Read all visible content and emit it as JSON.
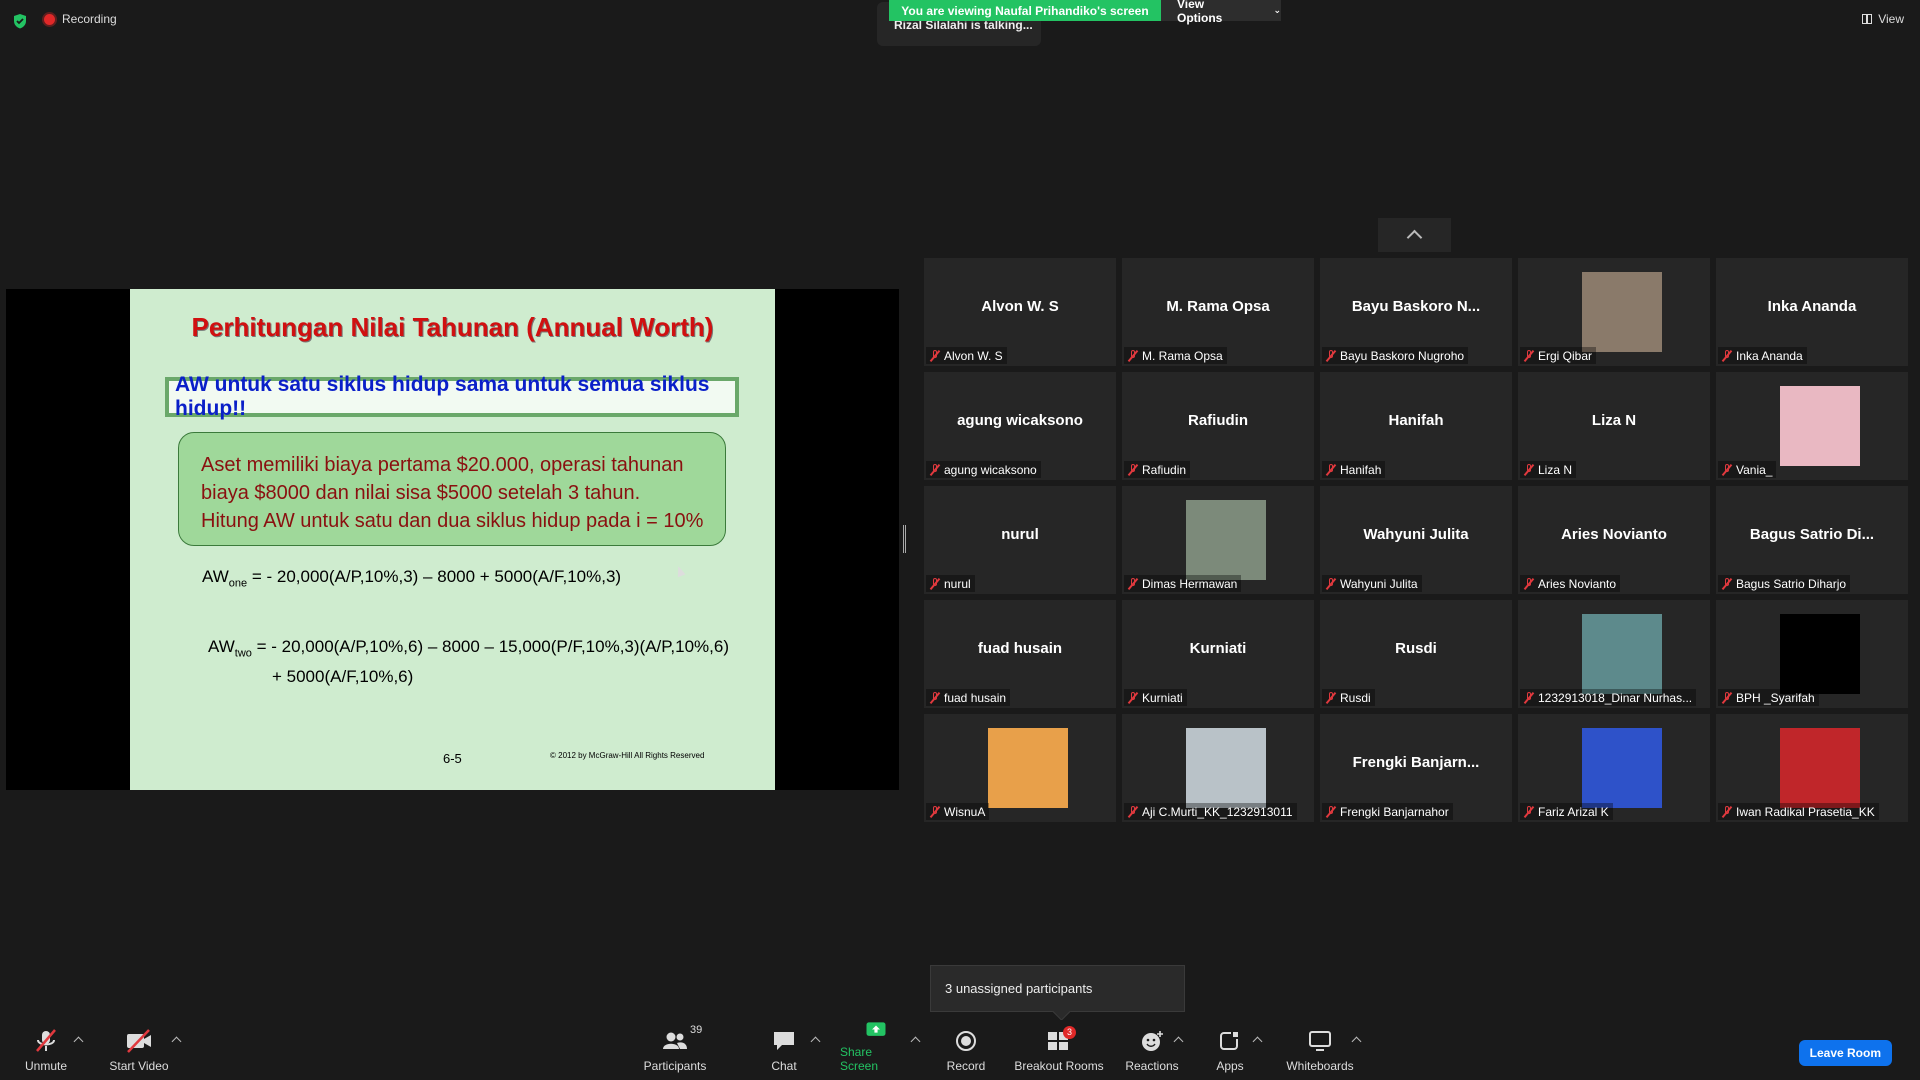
{
  "top": {
    "recording_label": "Recording",
    "talking": "Rizal Silalahi is talking...",
    "viewing": "You are viewing Naufal Prihandiko's screen",
    "view_options": "View Options",
    "view": "View"
  },
  "slide": {
    "title": "Perhitungan Nilai Tahunan (Annual Worth)",
    "box": "AW untuk satu siklus hidup sama untuk semua siklus hidup!!",
    "problem": [
      "Aset memiliki biaya pertama $20.000, operasi tahunan",
      "biaya $8000 dan nilai sisa $5000 setelah 3 tahun.",
      "Hitung AW untuk satu dan dua siklus hidup pada i = 10%"
    ],
    "eq1_lhs": "AW",
    "eq1_sub": "one",
    "eq1_rhs": " = - 20,000(A/P,10%,3) – 8000 + 5000(A/F,10%,3)",
    "eq2_lhs": "AW",
    "eq2_sub": "two",
    "eq2_rhs": " = - 20,000(A/P,10%,6) – 8000 – 15,000(P/F,10%,3)(A/P,10%,6)",
    "eq2_line2": "+ 5000(A/F,10%,6)",
    "page": "6-5",
    "copyright": "© 2012 by McGraw-Hill     All Rights Reserved"
  },
  "participants": [
    {
      "big": "Alvon W. S",
      "name": "Alvon W. S"
    },
    {
      "big": "M. Rama Opsa",
      "name": "M. Rama Opsa"
    },
    {
      "big": "Bayu Baskoro N...",
      "name": "Bayu Baskoro Nugroho"
    },
    {
      "big": "",
      "name": "Ergi Qibar"
    },
    {
      "big": "Inka Ananda",
      "name": "Inka Ananda"
    },
    {
      "big": "agung wicaksono",
      "name": "agung wicaksono"
    },
    {
      "big": "Rafiudin",
      "name": "Rafiudin"
    },
    {
      "big": "Hanifah",
      "name": "Hanifah"
    },
    {
      "big": "Liza N",
      "name": "Liza N"
    },
    {
      "big": "",
      "name": "Vania_"
    },
    {
      "big": "nurul",
      "name": "nurul"
    },
    {
      "big": "",
      "name": "Dimas Hermawan"
    },
    {
      "big": "Wahyuni Julita",
      "name": "Wahyuni Julita"
    },
    {
      "big": "Aries Novianto",
      "name": "Aries Novianto"
    },
    {
      "big": "Bagus Satrio Di...",
      "name": "Bagus Satrio Diharjo"
    },
    {
      "big": "fuad husain",
      "name": "fuad husain"
    },
    {
      "big": "Kurniati",
      "name": "Kurniati"
    },
    {
      "big": "Rusdi",
      "name": "Rusdi"
    },
    {
      "big": "",
      "name": "1232913018_Dinar Nurhas..."
    },
    {
      "big": "",
      "name": "BPH _Syarifah"
    },
    {
      "big": "",
      "name": "WisnuA"
    },
    {
      "big": "",
      "name": "Aji C.Murti_KK_1232913011"
    },
    {
      "big": "Frengki  Banjarn...",
      "name": "Frengki Banjarnahor"
    },
    {
      "big": "",
      "name": "Fariz Arizal K"
    },
    {
      "big": "",
      "name": "Iwan Radikal Prasetia_KK"
    }
  ],
  "avatars": {
    "Ergi Qibar": "#8a7a6a",
    "Vania_": "#e9b8c2",
    "Dimas Hermawan": "#7c8a7a",
    "1232913018_Dinar Nurhas...": "#5d8a8c",
    "BPH _Syarifah": "#000000",
    "WisnuA": "#e8a04a",
    "Aji C.Murti_KK_1232913011": "#b9c2c8",
    "Fariz Arizal K": "#2e52c9",
    "Iwan Radikal Prasetia_KK": "#c0262a"
  },
  "unassigned": "3 unassigned participants",
  "toolbar": {
    "unmute": "Unmute",
    "start_video": "Start Video",
    "participants": "Participants",
    "participant_count": "39",
    "chat": "Chat",
    "share_screen": "Share Screen",
    "record": "Record",
    "breakout_rooms": "Breakout Rooms",
    "breakout_badge": "3",
    "reactions": "Reactions",
    "apps": "Apps",
    "whiteboards": "Whiteboards",
    "leave": "Leave Room"
  },
  "colors": {
    "accent_green": "#23c363",
    "leave_blue": "#0e72ed",
    "muted_red": "#e0393e"
  }
}
